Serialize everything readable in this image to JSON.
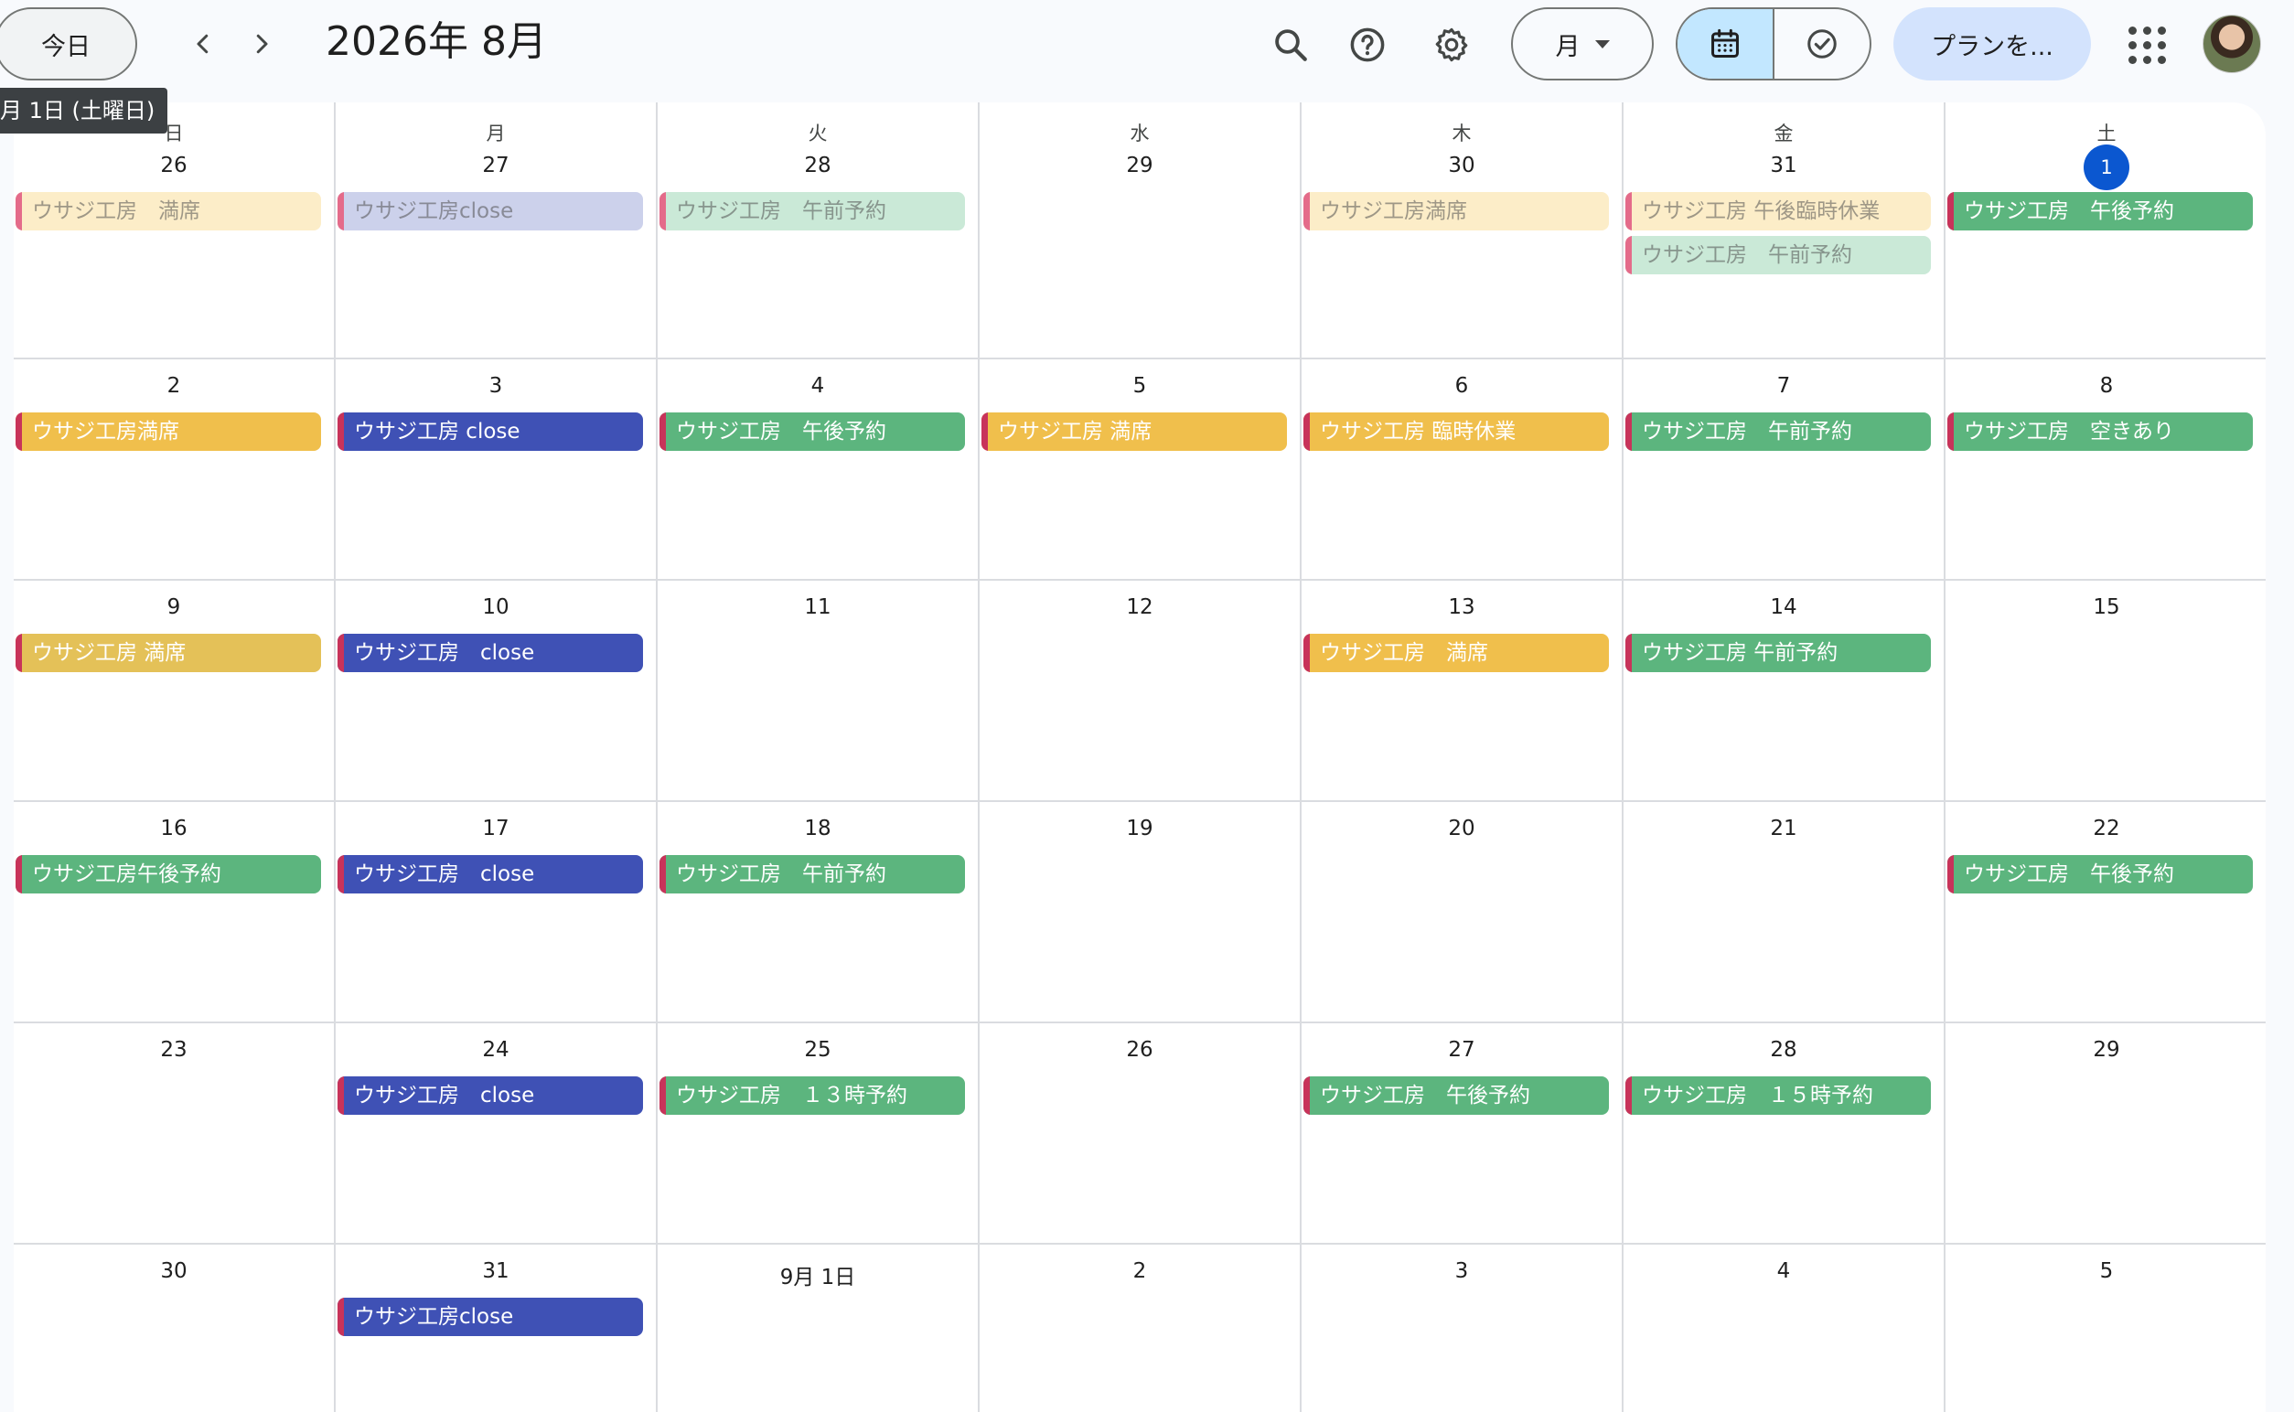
{
  "toolbar": {
    "today_label": "今日",
    "month_title": "2026年 8月",
    "view_label": "月",
    "plan_label": "プランを..."
  },
  "tooltip": "月 1日 (土曜日)",
  "colors": {
    "accent": "#0b57d0",
    "yellow": "#f0bf4c",
    "mustard": "#e4c158",
    "blue": "#3f51b5",
    "green": "#5cb57e",
    "lavender": "#7986cb",
    "past_yellow": "#f6d06e",
    "past_green": "#74c495",
    "event_bar": "#c8335a"
  },
  "weekdays": [
    "日",
    "月",
    "火",
    "水",
    "木",
    "金",
    "土"
  ],
  "weeks": [
    {
      "days": [
        {
          "label": "26",
          "events": [
            {
              "title": "ウサジ工房　満席",
              "color": "past_yellow",
              "past": true
            }
          ]
        },
        {
          "label": "27",
          "events": [
            {
              "title": "ウサジ工房close",
              "color": "lavender",
              "past": true
            }
          ]
        },
        {
          "label": "28",
          "events": [
            {
              "title": "ウサジ工房　午前予約",
              "color": "past_green",
              "past": true
            }
          ]
        },
        {
          "label": "29",
          "events": []
        },
        {
          "label": "30",
          "events": [
            {
              "title": "ウサジ工房満席",
              "color": "past_yellow",
              "past": true
            }
          ]
        },
        {
          "label": "31",
          "events": [
            {
              "title": "ウサジ工房 午後臨時休業",
              "color": "past_yellow",
              "past": true
            },
            {
              "title": "ウサジ工房　午前予約",
              "color": "past_green",
              "past": true
            }
          ]
        },
        {
          "label": "1",
          "today": true,
          "events": [
            {
              "title": "ウサジ工房　午後予約",
              "color": "green"
            }
          ]
        }
      ]
    },
    {
      "days": [
        {
          "label": "2",
          "events": [
            {
              "title": "ウサジ工房満席",
              "color": "yellow"
            }
          ]
        },
        {
          "label": "3",
          "events": [
            {
              "title": "ウサジ工房 close",
              "color": "blue"
            }
          ]
        },
        {
          "label": "4",
          "events": [
            {
              "title": "ウサジ工房　午後予約",
              "color": "green"
            }
          ]
        },
        {
          "label": "5",
          "events": [
            {
              "title": "ウサジ工房 満席",
              "color": "yellow"
            }
          ]
        },
        {
          "label": "6",
          "events": [
            {
              "title": "ウサジ工房 臨時休業",
              "color": "yellow"
            }
          ]
        },
        {
          "label": "7",
          "events": [
            {
              "title": "ウサジ工房　午前予約",
              "color": "green"
            }
          ]
        },
        {
          "label": "8",
          "events": [
            {
              "title": "ウサジ工房　空きあり",
              "color": "green"
            }
          ]
        }
      ]
    },
    {
      "days": [
        {
          "label": "9",
          "events": [
            {
              "title": "ウサジ工房 満席",
              "color": "mustard"
            }
          ]
        },
        {
          "label": "10",
          "events": [
            {
              "title": "ウサジ工房　close",
              "color": "blue"
            }
          ]
        },
        {
          "label": "11",
          "events": []
        },
        {
          "label": "12",
          "events": []
        },
        {
          "label": "13",
          "events": [
            {
              "title": "ウサジ工房　満席",
              "color": "yellow"
            }
          ]
        },
        {
          "label": "14",
          "events": [
            {
              "title": "ウサジ工房 午前予約",
              "color": "green"
            }
          ]
        },
        {
          "label": "15",
          "events": []
        }
      ]
    },
    {
      "days": [
        {
          "label": "16",
          "events": [
            {
              "title": "ウサジ工房午後予約",
              "color": "green"
            }
          ]
        },
        {
          "label": "17",
          "events": [
            {
              "title": "ウサジ工房　close",
              "color": "blue"
            }
          ]
        },
        {
          "label": "18",
          "events": [
            {
              "title": "ウサジ工房　午前予約",
              "color": "green"
            }
          ]
        },
        {
          "label": "19",
          "events": []
        },
        {
          "label": "20",
          "events": []
        },
        {
          "label": "21",
          "events": []
        },
        {
          "label": "22",
          "events": [
            {
              "title": "ウサジ工房　午後予約",
              "color": "green"
            }
          ]
        }
      ]
    },
    {
      "days": [
        {
          "label": "23",
          "events": []
        },
        {
          "label": "24",
          "events": [
            {
              "title": "ウサジ工房　close",
              "color": "blue"
            }
          ]
        },
        {
          "label": "25",
          "events": [
            {
              "title": "ウサジ工房　１３時予約",
              "color": "green"
            }
          ]
        },
        {
          "label": "26",
          "events": []
        },
        {
          "label": "27",
          "events": [
            {
              "title": "ウサジ工房　午後予約",
              "color": "green"
            }
          ]
        },
        {
          "label": "28",
          "events": [
            {
              "title": "ウサジ工房　１５時予約",
              "color": "green"
            }
          ]
        },
        {
          "label": "29",
          "events": []
        }
      ]
    },
    {
      "days": [
        {
          "label": "30",
          "events": []
        },
        {
          "label": "31",
          "events": [
            {
              "title": "ウサジ工房close",
              "color": "blue"
            }
          ]
        },
        {
          "label": "9月 1日",
          "events": []
        },
        {
          "label": "2",
          "events": []
        },
        {
          "label": "3",
          "events": []
        },
        {
          "label": "4",
          "events": []
        },
        {
          "label": "5",
          "events": []
        }
      ]
    }
  ]
}
